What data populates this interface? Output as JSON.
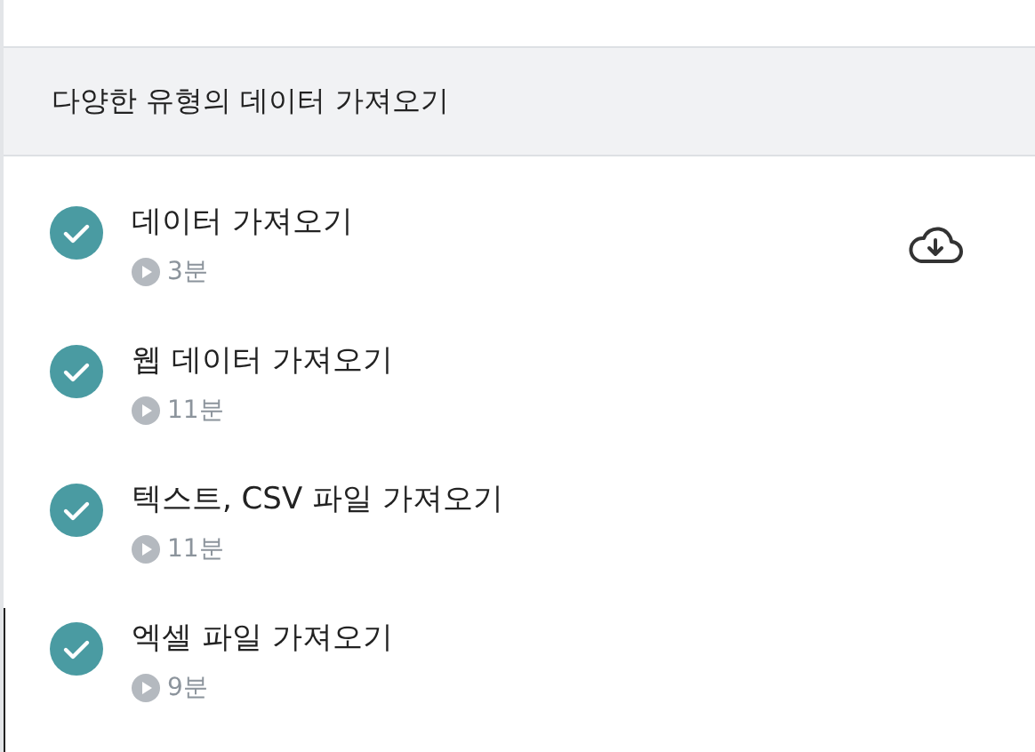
{
  "section": {
    "title": "다양한 유형의 데이터 가져오기"
  },
  "lessons": [
    {
      "title": "데이터 가져오기",
      "duration": "3분",
      "completed": true,
      "download": true,
      "selected": false
    },
    {
      "title": "웹 데이터 가져오기",
      "duration": "11분",
      "completed": true,
      "download": false,
      "selected": false
    },
    {
      "title": "텍스트, CSV 파일 가져오기",
      "duration": "11분",
      "completed": true,
      "download": false,
      "selected": false
    },
    {
      "title": "엑셀 파일 가져오기",
      "duration": "9분",
      "completed": true,
      "download": false,
      "selected": true
    }
  ]
}
